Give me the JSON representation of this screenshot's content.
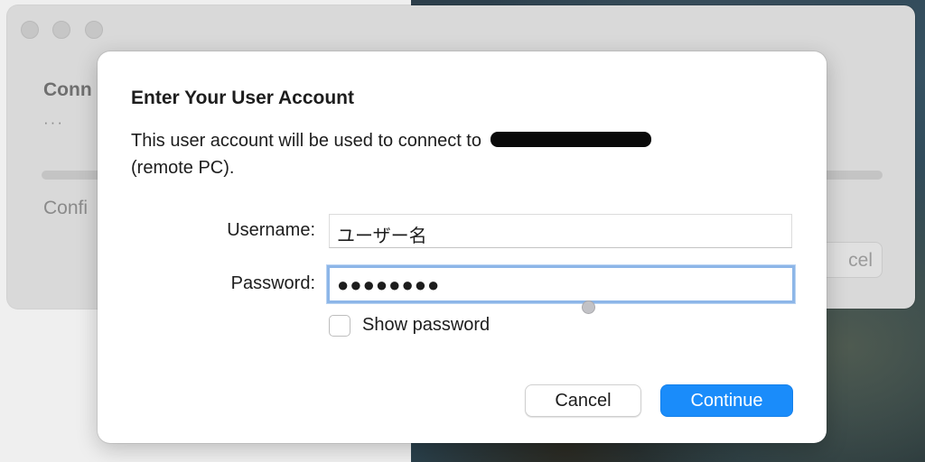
{
  "background_window": {
    "heading_partial": "Conn",
    "subtext_partial": "···",
    "config_partial": "Confi",
    "cancel_partial": "cel"
  },
  "dialog": {
    "title": "Enter Your User Account",
    "message_before": "This user account will be used to connect to",
    "message_after": "(remote PC).",
    "username_label": "Username:",
    "username_value": "ユーザー名",
    "password_label": "Password:",
    "password_value": "●●●●●●●●",
    "show_password_label": "Show password",
    "show_password_checked": false,
    "cancel_label": "Cancel",
    "continue_label": "Continue"
  },
  "colors": {
    "accent": "#1a8cfa",
    "focus_ring": "#8db6e8"
  }
}
